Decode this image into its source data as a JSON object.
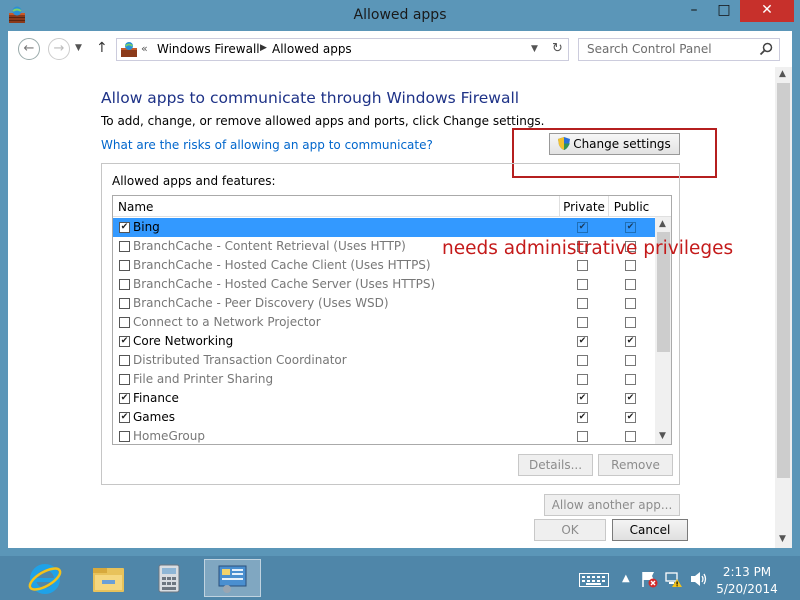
{
  "window": {
    "title": "Allowed apps",
    "minimize": "–",
    "maximize": "□",
    "close": "✕"
  },
  "navigation": {
    "back": "←",
    "forward": "→",
    "up": "↑",
    "breadcrumb_prefix": "«",
    "breadcrumbs": [
      "Windows Firewall",
      "Allowed apps"
    ],
    "refresh": "↻",
    "search_placeholder": "Search Control Panel"
  },
  "content": {
    "title": "Allow apps to communicate through Windows Firewall",
    "description": "To add, change, or remove allowed apps and ports, click Change settings.",
    "risk_link": "What are the risks of allowing an app to communicate?",
    "change_settings": "Change settings",
    "group_label": "Allowed apps and features:",
    "annotation": "needs administrative privileges"
  },
  "table": {
    "headers": {
      "name": "Name",
      "private": "Private",
      "public": "Public"
    },
    "rows": [
      {
        "name": "Bing",
        "enabled": true,
        "private": true,
        "public": true,
        "selected": true
      },
      {
        "name": "BranchCache - Content Retrieval (Uses HTTP)",
        "enabled": false,
        "private": false,
        "public": false,
        "selected": false
      },
      {
        "name": "BranchCache - Hosted Cache Client (Uses HTTPS)",
        "enabled": false,
        "private": false,
        "public": false,
        "selected": false
      },
      {
        "name": "BranchCache - Hosted Cache Server (Uses HTTPS)",
        "enabled": false,
        "private": false,
        "public": false,
        "selected": false
      },
      {
        "name": "BranchCache - Peer Discovery (Uses WSD)",
        "enabled": false,
        "private": false,
        "public": false,
        "selected": false
      },
      {
        "name": "Connect to a Network Projector",
        "enabled": false,
        "private": false,
        "public": false,
        "selected": false
      },
      {
        "name": "Core Networking",
        "enabled": true,
        "private": true,
        "public": true,
        "selected": false
      },
      {
        "name": "Distributed Transaction Coordinator",
        "enabled": false,
        "private": false,
        "public": false,
        "selected": false
      },
      {
        "name": "File and Printer Sharing",
        "enabled": false,
        "private": false,
        "public": false,
        "selected": false
      },
      {
        "name": "Finance",
        "enabled": true,
        "private": true,
        "public": true,
        "selected": false
      },
      {
        "name": "Games",
        "enabled": true,
        "private": true,
        "public": true,
        "selected": false
      },
      {
        "name": "HomeGroup",
        "enabled": false,
        "private": false,
        "public": false,
        "selected": false
      }
    ]
  },
  "buttons": {
    "details": "Details...",
    "remove": "Remove",
    "allow_another": "Allow another app...",
    "ok": "OK",
    "cancel": "Cancel"
  },
  "taskbar": {
    "apps": [
      "internet-explorer",
      "file-explorer",
      "calculator",
      "control-panel"
    ],
    "time": "2:13 PM",
    "date": "5/20/2014"
  },
  "colors": {
    "accent": "#5b96b8",
    "title_blue": "#1e3287",
    "link": "#0066cc",
    "annotation": "#c41a1a",
    "selection": "#3399ff"
  }
}
